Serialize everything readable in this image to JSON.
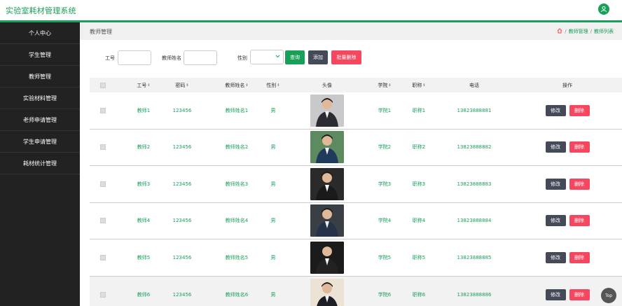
{
  "app": {
    "title": "实验室耗材管理系统"
  },
  "sidebar": {
    "items": [
      {
        "label": "个人中心"
      },
      {
        "label": "学生管理"
      },
      {
        "label": "教师管理"
      },
      {
        "label": "实验材料管理"
      },
      {
        "label": "老师申请管理"
      },
      {
        "label": "学生申请管理"
      },
      {
        "label": "耗材统计管理"
      }
    ]
  },
  "page": {
    "title": "教师管理",
    "breadcrumb": [
      "教师管理",
      "教师列表"
    ]
  },
  "filters": {
    "id_label": "工号",
    "id_value": "",
    "name_label": "教师姓名",
    "name_value": "",
    "gender_label": "性别",
    "gender_value": "",
    "search_button": "查询",
    "add_button": "添加",
    "batch_delete_button": "批量删除"
  },
  "table": {
    "headers": [
      "工号",
      "密码",
      "教师姓名",
      "性别",
      "头像",
      "学院",
      "职称",
      "电话",
      "操作"
    ],
    "edit_label": "修改",
    "delete_label": "删除",
    "rows": [
      {
        "id": "教师1",
        "password": "123456",
        "name": "教师姓名1",
        "gender": "男",
        "college": "学院1",
        "title": "职称1",
        "phone": "13823888881"
      },
      {
        "id": "教师2",
        "password": "123456",
        "name": "教师姓名2",
        "gender": "男",
        "college": "学院2",
        "title": "职称2",
        "phone": "13823888882"
      },
      {
        "id": "教师3",
        "password": "123456",
        "name": "教师姓名3",
        "gender": "男",
        "college": "学院3",
        "title": "职称3",
        "phone": "13823888883"
      },
      {
        "id": "教师4",
        "password": "123456",
        "name": "教师姓名4",
        "gender": "男",
        "college": "学院4",
        "title": "职称4",
        "phone": "13823888884"
      },
      {
        "id": "教师5",
        "password": "123456",
        "name": "教师姓名5",
        "gender": "男",
        "college": "学院5",
        "title": "职称5",
        "phone": "13823888885"
      },
      {
        "id": "教师6",
        "password": "123456",
        "name": "教师姓名6",
        "gender": "男",
        "college": "学院6",
        "title": "职称6",
        "phone": "13823888886"
      }
    ]
  },
  "back_to_top": "Top",
  "colors": {
    "accent": "#18a058",
    "sidebar_bg": "#222222",
    "danger": "#f5475f",
    "dark_button": "#444a58"
  }
}
